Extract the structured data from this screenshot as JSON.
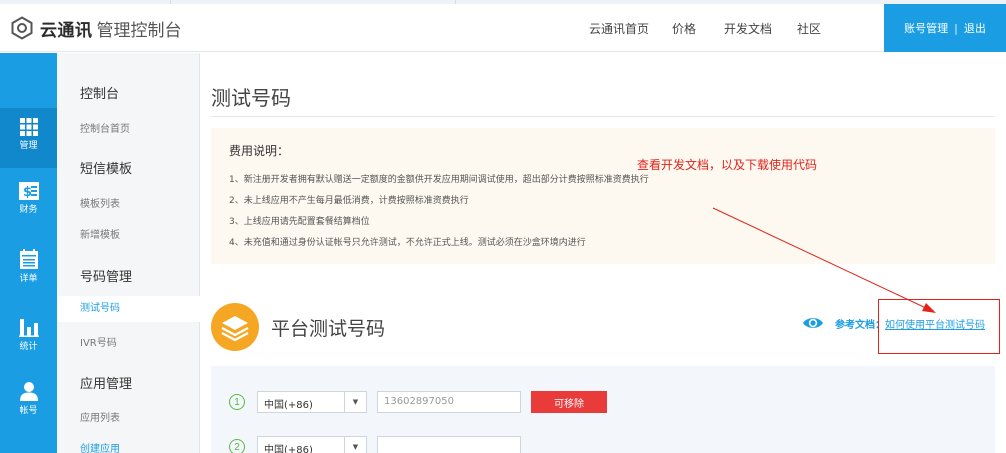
{
  "header": {
    "brand": "云通讯",
    "product": "管理控制台",
    "nav": [
      "云通讯首页",
      "价格",
      "开发文档",
      "社区"
    ],
    "account": {
      "manage": "账号管理",
      "separator": "|",
      "logout": "退出"
    }
  },
  "rail": [
    {
      "label": "管理",
      "icon": "grid-icon",
      "active": true
    },
    {
      "label": "财务",
      "icon": "finance-icon"
    },
    {
      "label": "详单",
      "icon": "calendar-icon"
    },
    {
      "label": "统计",
      "icon": "bar-chart-icon"
    },
    {
      "label": "帐号",
      "icon": "user-icon"
    }
  ],
  "submenu": {
    "console": {
      "group": "控制台",
      "items": [
        "控制台首页"
      ]
    },
    "sms": {
      "group": "短信模板",
      "items": [
        "模板列表",
        "新增模板"
      ]
    },
    "numbers": {
      "group": "号码管理",
      "items": [
        "测试号码",
        "IVR号码"
      ],
      "active": "测试号码"
    },
    "apps": {
      "group": "应用管理",
      "items": [
        "应用列表",
        "创建应用"
      ]
    }
  },
  "page": {
    "title": "测试号码",
    "notice_title": "费用说明：",
    "notice_items": [
      "1、新注册开发者拥有默认赠送一定额度的金额供开发应用期间调试使用，超出部分计费按照标准资费执行",
      "2、未上线应用不产生每月最低消费，计费按照标准资费执行",
      "3、上线应用请先配置套餐结算档位",
      "4、未充值和通过身份认证帐号只允许测试，不允许正式上线。测试必须在沙盒环境内进行"
    ],
    "annotation": "查看开发文档，以及下载使用代码",
    "section_title": "平台测试号码",
    "ref_label": "参考文档：",
    "ref_link": "如何使用平台测试号码",
    "rows": [
      {
        "index": "1",
        "country": "中国(+86)",
        "phone": "13602897050",
        "remove_label": "可移除"
      },
      {
        "index": "2",
        "country": "中国(+86)",
        "phone": ""
      }
    ]
  },
  "colors": {
    "primary": "#1b9de4",
    "accent_orange": "#f5a623",
    "danger": "#ea3b3b",
    "annotation_red": "#e0241b",
    "step_green": "#59b843"
  }
}
